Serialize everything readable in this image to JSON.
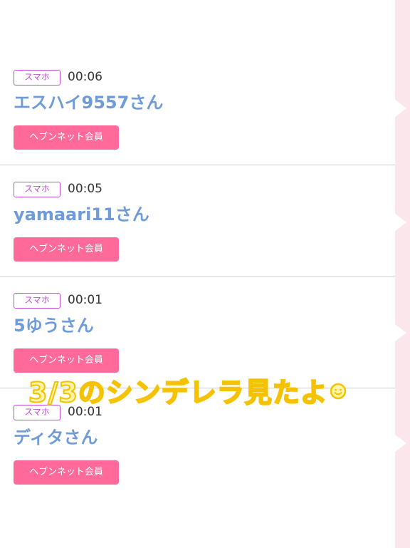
{
  "entries": [
    {
      "device": "スマホ",
      "time": "00:06",
      "name": "エスハイ9557さん",
      "member": "ヘブンネット会員"
    },
    {
      "device": "スマホ",
      "time": "00:05",
      "name": "yamaari11さん",
      "member": "ヘブンネット会員"
    },
    {
      "device": "スマホ",
      "time": "00:01",
      "name": "5ゆうさん",
      "member": "ヘブンネット会員"
    },
    {
      "device": "スマホ",
      "time": "00:01",
      "name": "ディタさん",
      "member": "ヘブンネット会員"
    }
  ],
  "overlay": {
    "caption": "3/3のシンデレラ見たよ",
    "emoji": "smiley-icon"
  },
  "colors": {
    "device_badge": "#c14fd3",
    "username": "#6f9bd8",
    "member_badge": "#ff6a9a",
    "overlay_fill": "#fff6a8",
    "overlay_stroke": "#f4c200",
    "side_strip": "#fbe6ec"
  }
}
